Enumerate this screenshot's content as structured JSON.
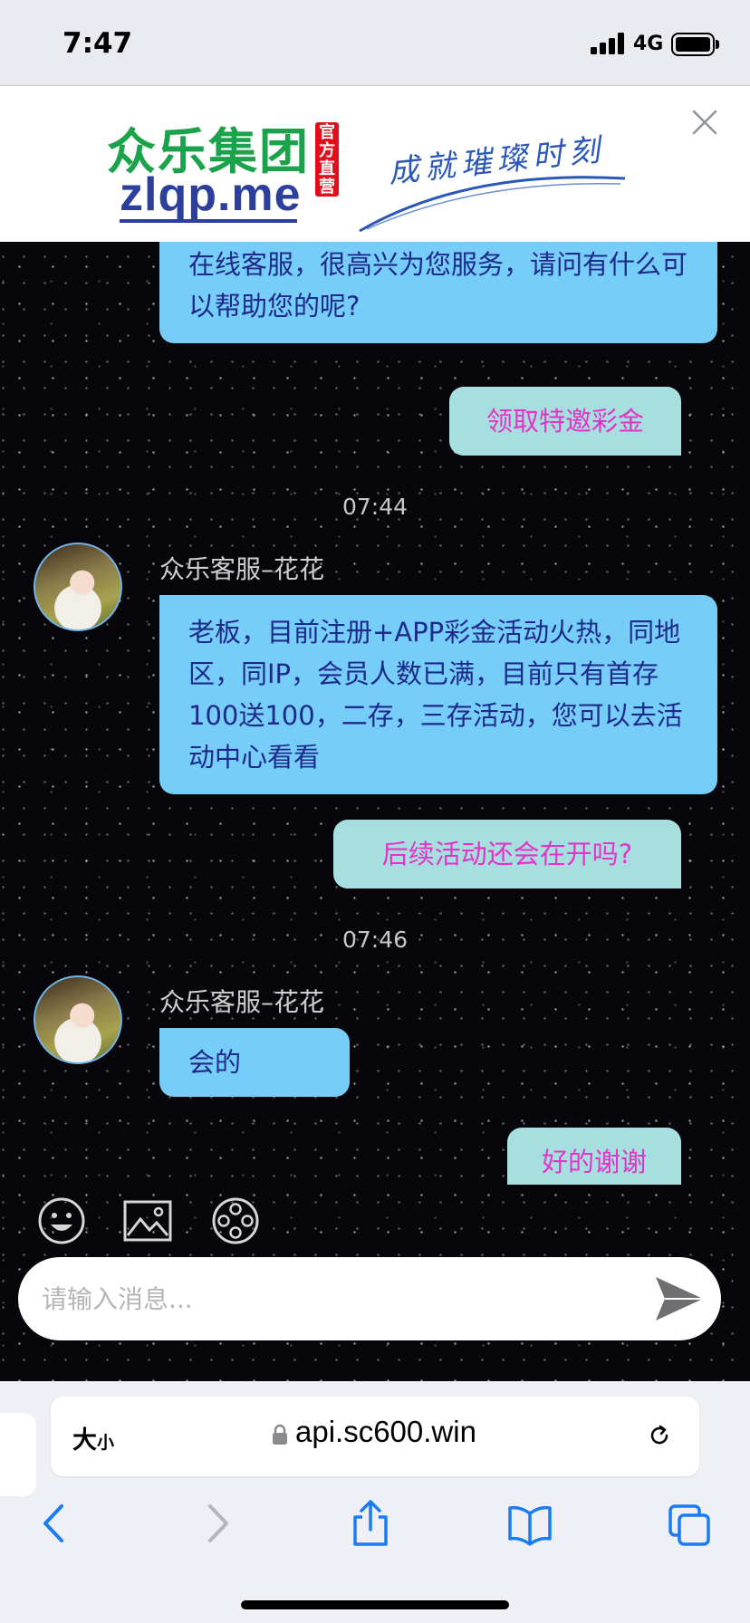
{
  "status": {
    "time": "7:47",
    "network": "4G"
  },
  "banner": {
    "brand_cn": "众乐集团",
    "badge": "官方直营",
    "domain": "zlqp.me",
    "slogan": "成就璀璨时刻"
  },
  "chat": {
    "messages": [
      {
        "role": "agent",
        "text": "在线客服，很高兴为您服务，请问有什么可以帮助您的呢?"
      },
      {
        "role": "user",
        "text": "领取特邀彩金"
      },
      {
        "role": "time",
        "text": "07:44"
      },
      {
        "role": "agent",
        "sender": "众乐客服–花花",
        "text": "老板，目前注册+APP彩金活动火热，同地区，同IP，会员人数已满，目前只有首存100送100，二存，三存活动，您可以去活动中心看看"
      },
      {
        "role": "user",
        "text": "后续活动还会在开吗?"
      },
      {
        "role": "time",
        "text": "07:46"
      },
      {
        "role": "agent",
        "sender": "众乐客服–花花",
        "text": "会的"
      },
      {
        "role": "user",
        "text": "好的谢谢"
      }
    ]
  },
  "toolbar": {
    "icons": [
      "emoji-icon",
      "image-icon",
      "video-reel-icon"
    ]
  },
  "input": {
    "placeholder": "请输入消息..."
  },
  "browser": {
    "text_size_big": "大",
    "text_size_small": "小",
    "url": "api.sc600.win"
  },
  "colors": {
    "agent_bubble": "#76cdf7",
    "user_bubble": "#a7dfe0",
    "user_text": "#e334c7",
    "agent_text": "#1d2a8c"
  }
}
